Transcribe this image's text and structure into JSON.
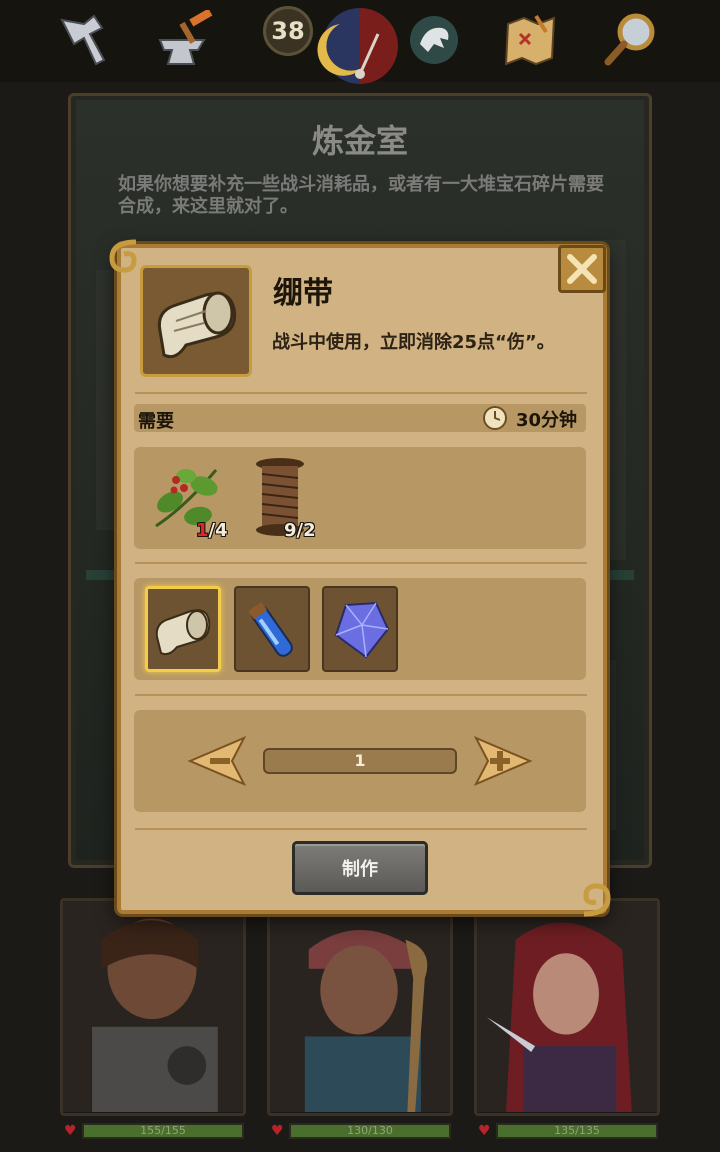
{
  "topbar": {
    "day_count": "38",
    "icons": [
      "axe-icon",
      "anvil-icon",
      "daynight-dial-icon",
      "dragon-icon",
      "map-icon",
      "magnifier-icon"
    ]
  },
  "room": {
    "title": "炼金室",
    "description": "如果你想要补充一些战斗消耗品，或者有一大堆宝石碎片需要合成，来这里就对了。"
  },
  "dialog": {
    "item": {
      "name": "绷带",
      "icon": "bandage-icon",
      "description": "战斗中使用，立即消除25点“伤”。"
    },
    "requirements": {
      "label": "需要",
      "time": "30分钟",
      "materials": [
        {
          "icon": "herb-icon",
          "have": "1",
          "need": "/4"
        },
        {
          "icon": "thread-spool-icon",
          "have": "9",
          "need": "/2"
        }
      ]
    },
    "recipes": [
      {
        "icon": "bandage-icon",
        "selected": true
      },
      {
        "icon": "blue-potion-icon",
        "selected": false
      },
      {
        "icon": "crystal-icon",
        "selected": false
      }
    ],
    "quantity": "1",
    "craft_label": "制作"
  },
  "heroes": [
    {
      "name": "warrior",
      "hp": "155/155"
    },
    {
      "name": "mystic",
      "hp": "130/130"
    },
    {
      "name": "rogue",
      "hp": "135/135"
    }
  ],
  "colors": {
    "dialog_bg": "#d0b283",
    "dialog_border": "#a97b35",
    "panel": "#b79865",
    "selected_glow": "#f2cc4a",
    "shortage_red": "#e0262c"
  }
}
